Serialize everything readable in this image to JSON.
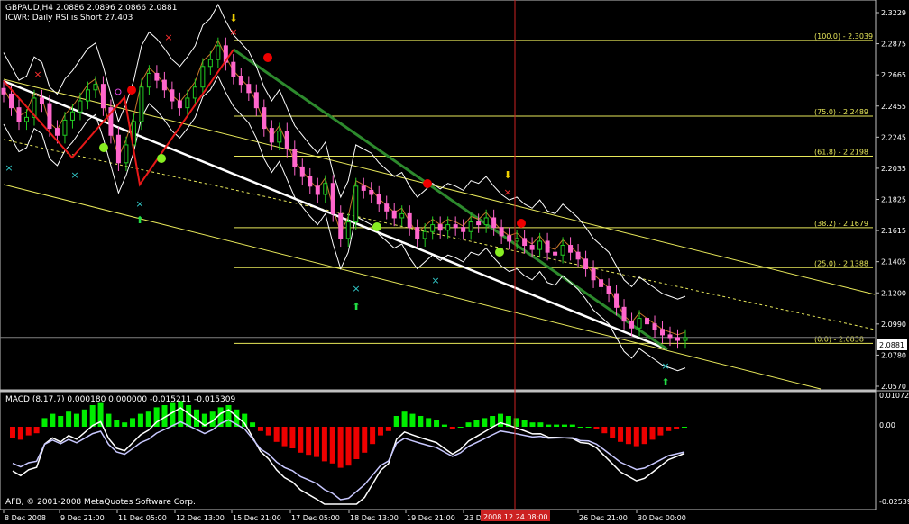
{
  "header": {
    "symbol_line": "GBPAUD,H4  2.0886 2.0896 2.0866 2.0881",
    "indicator_line": "ICWR: Daily RSI is Short 27.403"
  },
  "macd": {
    "label": "MACD  (8,17,7) 0.000180 0.000000 -0.015211 -0.015309",
    "ticks": [
      "0.01072",
      "0.00",
      "-0.02539"
    ]
  },
  "copyright": "AFB, © 2001-2008 MetaQuotes Software Corp.",
  "current_price": "2.0881",
  "cursor_time": "2008.12.24 08:00",
  "colors": {
    "bg": "#000000",
    "bull_candle": "#22cc22",
    "bear_candle": "#ff66cc",
    "fib": "#e8e85a",
    "cursor": "#cc2222",
    "macd_pos": "#00ee00",
    "macd_neg": "#ee0000",
    "zigzag": "#e81818",
    "trend": "#ffffff"
  },
  "chart_data": {
    "type": "candlestick",
    "price_ticks": [
      "2.3229",
      "2.2875",
      "2.2665",
      "2.2455",
      "2.2245",
      "2.2035",
      "2.1825",
      "2.1615",
      "2.1405",
      "2.1200",
      "2.0990",
      "2.0780",
      "2.0570"
    ],
    "time_ticks": [
      "8 Dec 2008",
      "9 Dec 21:00",
      "11 Dec 05:00",
      "12 Dec 13:00",
      "15 Dec 21:00",
      "17 Dec 05:00",
      "18 Dec 13:00",
      "19 Dec 21:00",
      "23 Dec",
      "26 Dec 21:00",
      "30 Dec 00:00"
    ],
    "fib_levels": [
      {
        "label": "(100.0) - 2.3039",
        "price": 2.3039
      },
      {
        "label": "(75.0) - 2.2489",
        "price": 2.2489
      },
      {
        "label": "(61.8) - 2.2198",
        "price": 2.2198
      },
      {
        "label": "(38.2) - 2.1679",
        "price": 2.1679
      },
      {
        "label": "(25.0) - 2.1388",
        "price": 2.1388
      },
      {
        "label": "(0.0) - 2.0838",
        "price": 2.0838
      }
    ],
    "price_range": [
      2.052,
      2.33
    ],
    "close_series": [
      2.265,
      2.255,
      2.245,
      2.248,
      2.262,
      2.258,
      2.24,
      2.235,
      2.246,
      2.252,
      2.26,
      2.268,
      2.272,
      2.255,
      2.235,
      2.215,
      2.228,
      2.245,
      2.27,
      2.28,
      2.275,
      2.268,
      2.26,
      2.255,
      2.262,
      2.27,
      2.285,
      2.29,
      2.3,
      2.288,
      2.278,
      2.272,
      2.266,
      2.255,
      2.24,
      2.23,
      2.238,
      2.225,
      2.212,
      2.205,
      2.198,
      2.192,
      2.2,
      2.178,
      2.16,
      2.172,
      2.198,
      2.195,
      2.192,
      2.185,
      2.18,
      2.175,
      2.178,
      2.168,
      2.16,
      2.165,
      2.17,
      2.166,
      2.17,
      2.168,
      2.165,
      2.172,
      2.17,
      2.175,
      2.168,
      2.162,
      2.158,
      2.16,
      2.155,
      2.152,
      2.158,
      2.15,
      2.148,
      2.155,
      2.15,
      2.145,
      2.138,
      2.13,
      2.125,
      2.12,
      2.11,
      2.1,
      2.095,
      2.102,
      2.098,
      2.094,
      2.09,
      2.088,
      2.086,
      2.088
    ],
    "macd_hist": [
      -0.005,
      -0.006,
      -0.004,
      -0.003,
      0.004,
      0.006,
      0.005,
      0.007,
      0.006,
      0.008,
      0.01,
      0.011,
      0.006,
      0.003,
      0.002,
      0.004,
      0.006,
      0.007,
      0.009,
      0.01,
      0.011,
      0.012,
      0.01,
      0.008,
      0.006,
      0.007,
      0.009,
      0.01,
      0.008,
      0.006,
      0.002,
      -0.002,
      -0.004,
      -0.007,
      -0.009,
      -0.01,
      -0.012,
      -0.013,
      -0.014,
      -0.016,
      -0.017,
      -0.019,
      -0.018,
      -0.015,
      -0.012,
      -0.008,
      -0.004,
      -0.002,
      0.005,
      0.007,
      0.006,
      0.005,
      0.004,
      0.003,
      0.001,
      -0.001,
      0.0,
      0.002,
      0.003,
      0.004,
      0.005,
      0.006,
      0.005,
      0.004,
      0.003,
      0.002,
      0.002,
      0.001,
      0.001,
      0.001,
      0.001,
      0.0,
      0.0,
      -0.001,
      -0.003,
      -0.005,
      -0.007,
      -0.008,
      -0.009,
      -0.008,
      -0.006,
      -0.004,
      -0.002,
      -0.001,
      0.0
    ]
  }
}
